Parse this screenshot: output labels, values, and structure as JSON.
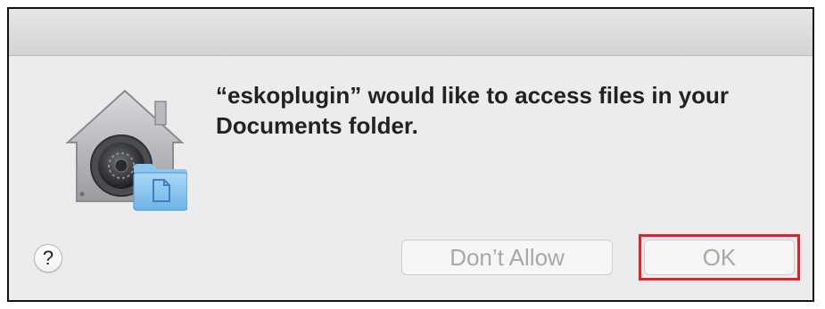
{
  "dialog": {
    "message": "“eskoplugin” would like to access files in your Documents folder.",
    "help_label": "?",
    "dont_allow_label": "Don’t Allow",
    "ok_label": "OK",
    "icon": "privacy-folder-icon"
  },
  "colors": {
    "highlight": "#e0202a",
    "dialog_bg": "#ececec",
    "button_text_disabled": "#a8a8a8"
  }
}
